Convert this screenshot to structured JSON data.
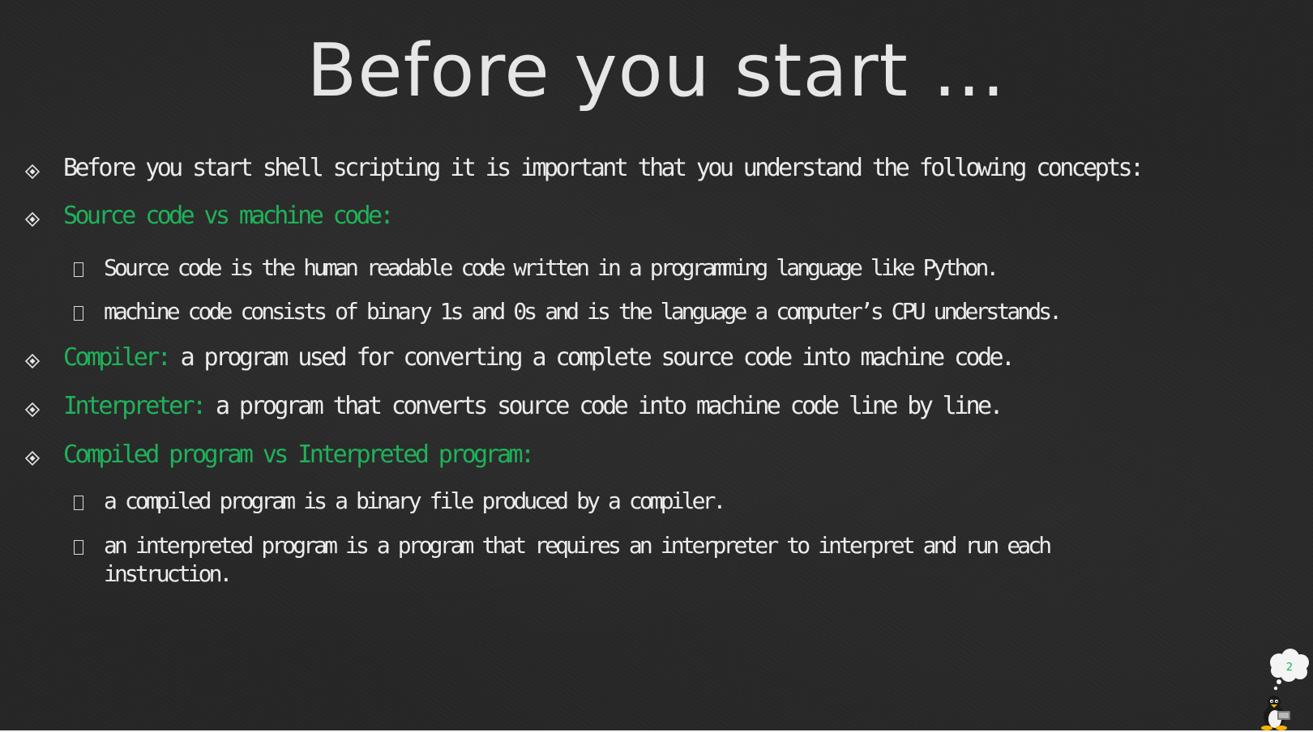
{
  "title": "Before you start …",
  "bullets": {
    "intro": "Before you start shell scripting it is important that you understand the following concepts:",
    "source_vs_machine": {
      "heading": "Source code vs machine code:",
      "items": [
        "Source code is the human readable code written in a programming language like Python.",
        "machine code  consists of binary 1s and 0s and is the language a computer’s CPU understands."
      ]
    },
    "compiler": {
      "term": "Compiler:",
      "definition": " a program used for converting a complete source code into machine code."
    },
    "interpreter": {
      "term": "Interpreter:",
      "definition": " a program that converts source code into machine code line by line."
    },
    "compiled_vs_interpreted": {
      "heading": "Compiled program vs Interpreted program:",
      "items": [
        "a compiled program is a binary file produced by a compiler.",
        "an interpreted program is a program that requires an interpreter to interpret and run each",
        "instruction."
      ]
    }
  },
  "page_number": "2",
  "colors": {
    "background": "#262626",
    "title": "#e6e6e6",
    "text": "#ececec",
    "accent_green": "#1fb25a"
  },
  "icons": {
    "level1_bullet": "diamond-bullet-icon",
    "level2_bullet": "square-bullet-icon",
    "corner_logo": "tux-penguin-icon"
  }
}
